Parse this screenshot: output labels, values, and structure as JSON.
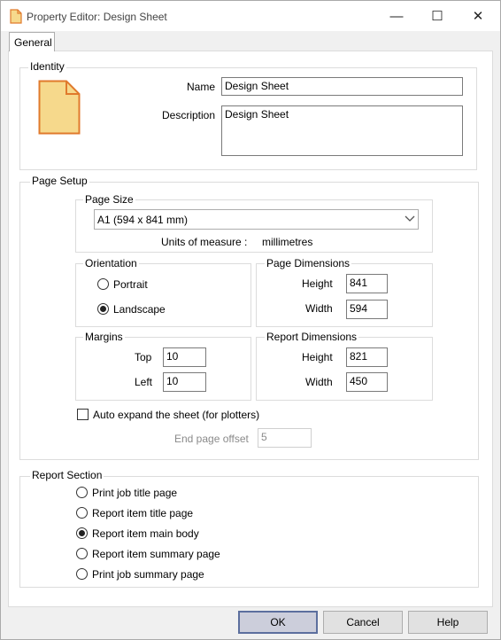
{
  "window": {
    "title": "Property Editor: Design Sheet",
    "minimize_glyph": "—",
    "maximize_glyph": "☐",
    "close_glyph": "✕"
  },
  "tabs": [
    {
      "label": "General",
      "active": true
    }
  ],
  "identity": {
    "legend": "Identity",
    "icon": "document-icon",
    "name_label": "Name",
    "name_value": "Design Sheet",
    "description_label": "Description",
    "description_value": "Design Sheet"
  },
  "page_setup": {
    "legend": "Page Setup",
    "page_size": {
      "legend": "Page Size",
      "selected": "A1 (594 x 841 mm)",
      "units_label": "Units of measure :",
      "units_value": "millimetres"
    },
    "orientation": {
      "legend": "Orientation",
      "options": [
        {
          "label": "Portrait",
          "checked": false
        },
        {
          "label": "Landscape",
          "checked": true
        }
      ]
    },
    "page_dimensions": {
      "legend": "Page Dimensions",
      "height_label": "Height",
      "height_value": "841",
      "width_label": "Width",
      "width_value": "594"
    },
    "margins": {
      "legend": "Margins",
      "top_label": "Top",
      "top_value": "10",
      "left_label": "Left",
      "left_value": "10"
    },
    "report_dimensions": {
      "legend": "Report Dimensions",
      "height_label": "Height",
      "height_value": "821",
      "width_label": "Width",
      "width_value": "450"
    },
    "auto_expand_label": "Auto expand the sheet (for plotters)",
    "auto_expand_checked": false,
    "end_page_offset_label": "End page offset",
    "end_page_offset_value": "5"
  },
  "report_section": {
    "legend": "Report Section",
    "options": [
      {
        "label": "Print job title page",
        "checked": false
      },
      {
        "label": "Report item title page",
        "checked": false
      },
      {
        "label": "Report item main body",
        "checked": true
      },
      {
        "label": "Report item summary page",
        "checked": false
      },
      {
        "label": "Print job summary page",
        "checked": false
      }
    ]
  },
  "buttons": {
    "ok": "OK",
    "cancel": "Cancel",
    "help": "Help"
  }
}
